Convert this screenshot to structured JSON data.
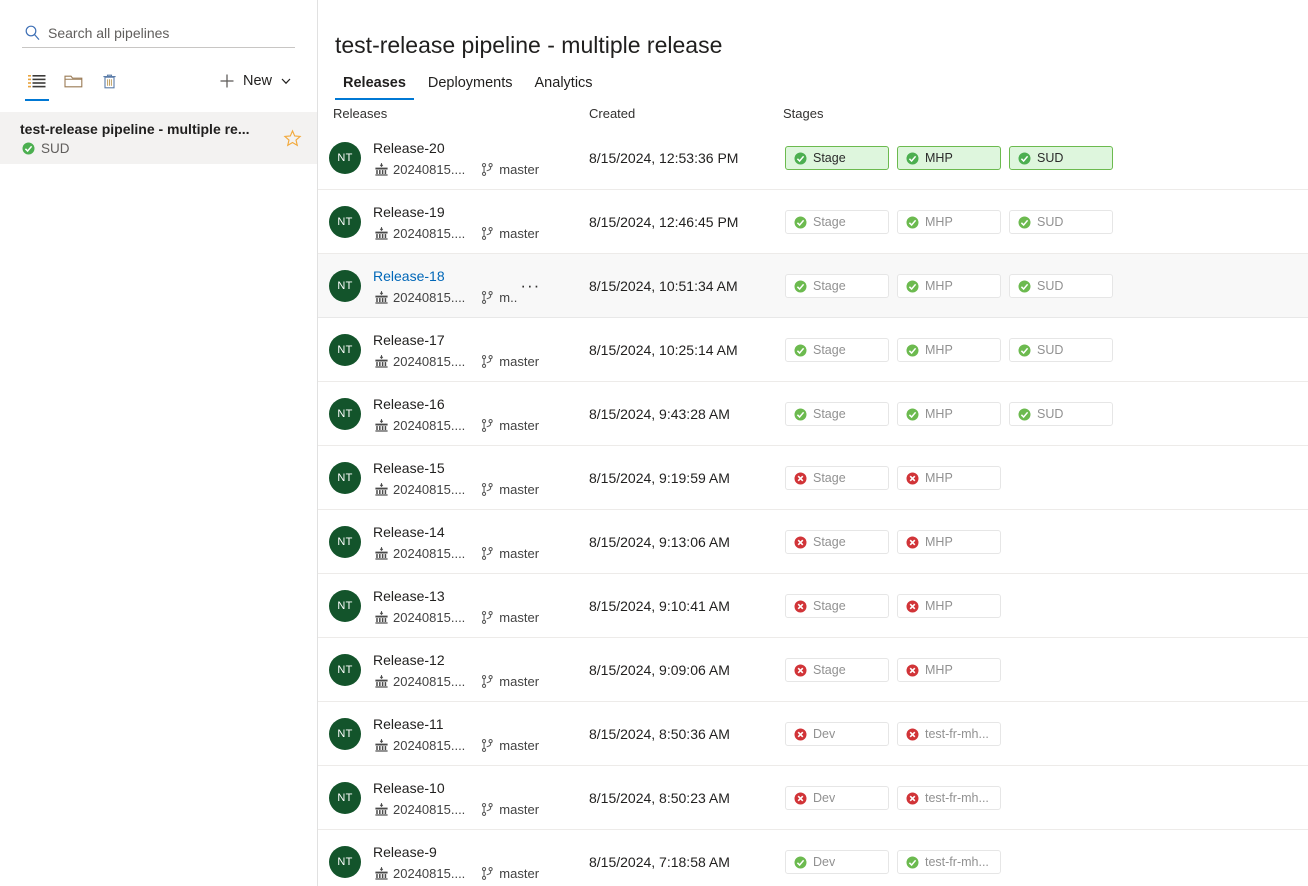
{
  "sidebar": {
    "search": {
      "placeholder": "Search all pipelines",
      "value": "",
      "icon": "search-icon"
    },
    "toolbar": {
      "list_view_icon": "list-view-icon",
      "folder_icon": "folder-icon",
      "delete_icon": "trash-icon",
      "new_label": "New",
      "new_plus_icon": "plus-icon",
      "new_chevron_icon": "chevron-down-icon"
    },
    "pipelines": [
      {
        "title": "test-release pipeline - multiple re...",
        "status_label": "SUD",
        "status": "succeeded",
        "favorite_icon": "star-icon",
        "favorite": false,
        "selected": true
      }
    ]
  },
  "header": {
    "title": "test-release pipeline - multiple release",
    "tabs": [
      {
        "label": "Releases",
        "active": true
      },
      {
        "label": "Deployments",
        "active": false
      },
      {
        "label": "Analytics",
        "active": false
      }
    ]
  },
  "table": {
    "columns": {
      "releases": "Releases",
      "created": "Created",
      "stages": "Stages"
    },
    "rows": [
      {
        "name": "Release-20",
        "avatar": "NT",
        "artifact": "20240815....",
        "branch": "master",
        "created": "8/15/2024, 12:53:36 PM",
        "hovered": false,
        "current": true,
        "stages": [
          {
            "label": "Stage",
            "status": "succeeded"
          },
          {
            "label": "MHP",
            "status": "succeeded"
          },
          {
            "label": "SUD",
            "status": "succeeded"
          }
        ]
      },
      {
        "name": "Release-19",
        "avatar": "NT",
        "artifact": "20240815....",
        "branch": "master",
        "created": "8/15/2024, 12:46:45 PM",
        "hovered": false,
        "current": false,
        "stages": [
          {
            "label": "Stage",
            "status": "succeeded"
          },
          {
            "label": "MHP",
            "status": "succeeded"
          },
          {
            "label": "SUD",
            "status": "succeeded"
          }
        ]
      },
      {
        "name": "Release-18",
        "avatar": "NT",
        "artifact": "20240815....",
        "branch": "m..",
        "created": "8/15/2024, 10:51:34 AM",
        "hovered": true,
        "current": false,
        "overflow_label": "···",
        "stages": [
          {
            "label": "Stage",
            "status": "succeeded"
          },
          {
            "label": "MHP",
            "status": "succeeded"
          },
          {
            "label": "SUD",
            "status": "succeeded"
          }
        ]
      },
      {
        "name": "Release-17",
        "avatar": "NT",
        "artifact": "20240815....",
        "branch": "master",
        "created": "8/15/2024, 10:25:14 AM",
        "hovered": false,
        "current": false,
        "stages": [
          {
            "label": "Stage",
            "status": "succeeded"
          },
          {
            "label": "MHP",
            "status": "succeeded"
          },
          {
            "label": "SUD",
            "status": "succeeded"
          }
        ]
      },
      {
        "name": "Release-16",
        "avatar": "NT",
        "artifact": "20240815....",
        "branch": "master",
        "created": "8/15/2024, 9:43:28 AM",
        "hovered": false,
        "current": false,
        "stages": [
          {
            "label": "Stage",
            "status": "succeeded"
          },
          {
            "label": "MHP",
            "status": "succeeded"
          },
          {
            "label": "SUD",
            "status": "succeeded"
          }
        ]
      },
      {
        "name": "Release-15",
        "avatar": "NT",
        "artifact": "20240815....",
        "branch": "master",
        "created": "8/15/2024, 9:19:59 AM",
        "hovered": false,
        "current": false,
        "stages": [
          {
            "label": "Stage",
            "status": "failed"
          },
          {
            "label": "MHP",
            "status": "failed"
          }
        ]
      },
      {
        "name": "Release-14",
        "avatar": "NT",
        "artifact": "20240815....",
        "branch": "master",
        "created": "8/15/2024, 9:13:06 AM",
        "hovered": false,
        "current": false,
        "stages": [
          {
            "label": "Stage",
            "status": "failed"
          },
          {
            "label": "MHP",
            "status": "failed"
          }
        ]
      },
      {
        "name": "Release-13",
        "avatar": "NT",
        "artifact": "20240815....",
        "branch": "master",
        "created": "8/15/2024, 9:10:41 AM",
        "hovered": false,
        "current": false,
        "stages": [
          {
            "label": "Stage",
            "status": "failed"
          },
          {
            "label": "MHP",
            "status": "failed"
          }
        ]
      },
      {
        "name": "Release-12",
        "avatar": "NT",
        "artifact": "20240815....",
        "branch": "master",
        "created": "8/15/2024, 9:09:06 AM",
        "hovered": false,
        "current": false,
        "stages": [
          {
            "label": "Stage",
            "status": "failed"
          },
          {
            "label": "MHP",
            "status": "failed"
          }
        ]
      },
      {
        "name": "Release-11",
        "avatar": "NT",
        "artifact": "20240815....",
        "branch": "master",
        "created": "8/15/2024, 8:50:36 AM",
        "hovered": false,
        "current": false,
        "stages": [
          {
            "label": "Dev",
            "status": "failed"
          },
          {
            "label": "test-fr-mh...",
            "status": "failed"
          }
        ]
      },
      {
        "name": "Release-10",
        "avatar": "NT",
        "artifact": "20240815....",
        "branch": "master",
        "created": "8/15/2024, 8:50:23 AM",
        "hovered": false,
        "current": false,
        "stages": [
          {
            "label": "Dev",
            "status": "failed"
          },
          {
            "label": "test-fr-mh...",
            "status": "failed"
          }
        ]
      },
      {
        "name": "Release-9",
        "avatar": "NT",
        "artifact": "20240815....",
        "branch": "master",
        "created": "8/15/2024, 7:18:58 AM",
        "hovered": false,
        "current": false,
        "stages": [
          {
            "label": "Dev",
            "status": "succeeded"
          },
          {
            "label": "test-fr-mh...",
            "status": "succeeded"
          }
        ]
      }
    ]
  },
  "colors": {
    "accent": "#0078d4",
    "link": "#0067b8",
    "avatar": "#13542b",
    "success": "#107c10",
    "success_chip_bg": "#def6dd",
    "success_chip_border": "#6cba4f",
    "failure": "#d13438",
    "favorite": "#f2a93b"
  }
}
